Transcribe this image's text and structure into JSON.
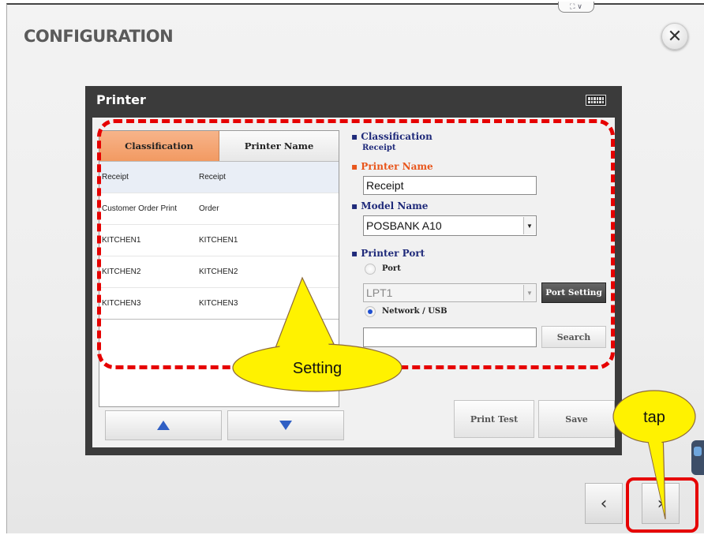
{
  "header": {
    "title": "CONFIGURATION",
    "close_glyph": "✕",
    "top_tab_glyph": "⛶ ∨"
  },
  "dialog": {
    "title": "Printer",
    "keyboard_icon": "keyboard-icon"
  },
  "printer_list": {
    "columns": [
      "Classification",
      "Printer Name"
    ],
    "rows": [
      {
        "classification": "Receipt",
        "printer_name": "Receipt"
      },
      {
        "classification": "Customer Order Print",
        "printer_name": "Order"
      },
      {
        "classification": "KITCHEN1",
        "printer_name": "KITCHEN1"
      },
      {
        "classification": "KITCHEN2",
        "printer_name": "KITCHEN2"
      },
      {
        "classification": "KITCHEN3",
        "printer_name": "KITCHEN3"
      }
    ],
    "selected_index": 0
  },
  "form": {
    "classification_label": "▪ Classification",
    "classification_value": "Receipt",
    "printer_name_label": "▪ Printer Name",
    "printer_name_value": "Receipt",
    "model_name_label": "▪ Model Name",
    "model_name_value": "POSBANK A10",
    "printer_port_label": "▪ Printer Port",
    "port_radio_label": "Port",
    "port_value": "LPT1",
    "port_setting_button": "Port Setting",
    "network_radio_label": "Network / USB",
    "network_value": "",
    "search_button": "Search",
    "selected_port_type": "Network / USB"
  },
  "actions": {
    "print_test": "Print Test",
    "save": "Save"
  },
  "page_nav": {
    "prev_glyph": "‹",
    "next_glyph": "›"
  },
  "annotations": {
    "setting_callout": "Setting",
    "tap_callout": "tap"
  },
  "colors": {
    "accent_orange": "#f29a62",
    "label_navy": "#1f2a7a",
    "label_orange": "#e8561c",
    "annotation_red": "#e60000",
    "callout_yellow": "#fff200"
  }
}
